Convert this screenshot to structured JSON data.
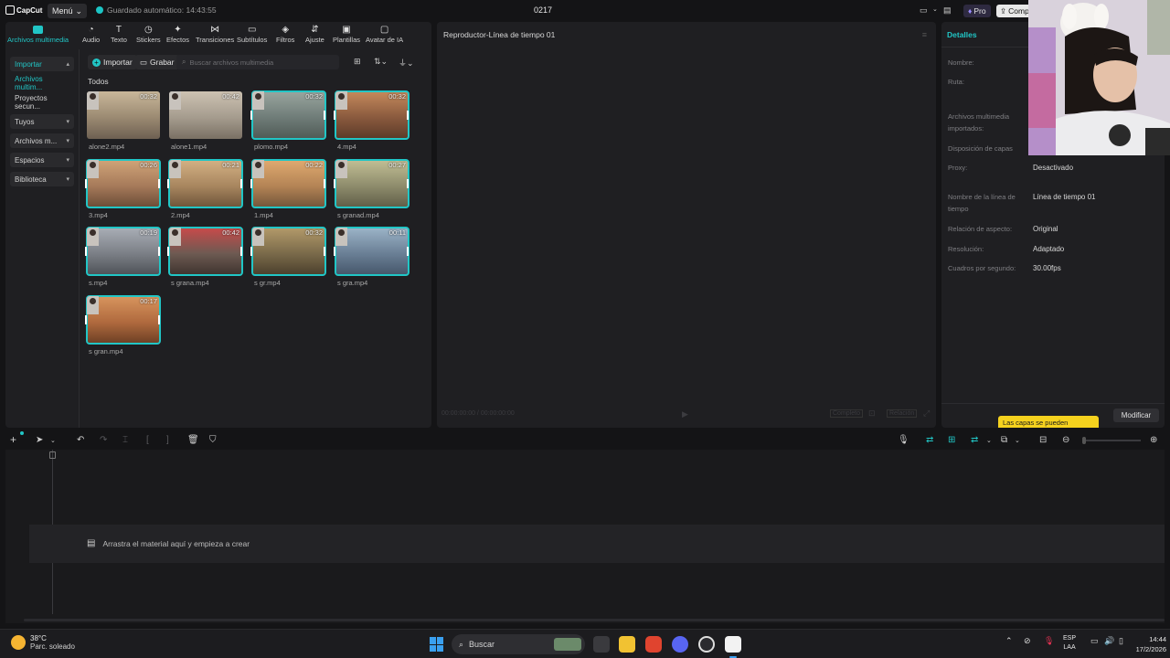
{
  "titlebar": {
    "logo_text": "CapCut",
    "menu_label": "Menú",
    "autosave": "Guardado automático: 14:43:55",
    "project_title": "0217",
    "pro_label": "Pro",
    "comp_label": "Comp"
  },
  "toolbar": {
    "items": [
      {
        "label": "Archivos multimedia",
        "icon": "media-icon",
        "active": true
      },
      {
        "label": "Audio",
        "icon": "audio-icon"
      },
      {
        "label": "Texto",
        "icon": "text-icon"
      },
      {
        "label": "Stickers",
        "icon": "sticker-icon"
      },
      {
        "label": "Efectos",
        "icon": "effects-icon"
      },
      {
        "label": "Transiciones",
        "icon": "transitions-icon"
      },
      {
        "label": "Subtítulos",
        "icon": "subtitles-icon"
      },
      {
        "label": "Filtros",
        "icon": "filters-icon"
      },
      {
        "label": "Ajuste",
        "icon": "adjust-icon"
      },
      {
        "label": "Plantillas",
        "icon": "templates-icon"
      },
      {
        "label": "Avatar de IA",
        "icon": "ai-avatar-icon"
      }
    ]
  },
  "sidebar": {
    "items": [
      {
        "label": "Importar",
        "chevron": "▴",
        "active": true
      },
      {
        "label": "Archivos multim...",
        "active": true,
        "plain": true
      },
      {
        "label": "Proyectos secun...",
        "plain": true
      },
      {
        "label": "Tuyos",
        "chevron": "▾"
      },
      {
        "label": "Archivos m...",
        "chevron": "▾"
      },
      {
        "label": "Espacios",
        "chevron": "▾"
      },
      {
        "label": "Biblioteca",
        "chevron": "▾"
      }
    ]
  },
  "media": {
    "import_label": "Importar",
    "record_label": "Grabar",
    "search_placeholder": "Buscar archivos multimedia",
    "section": "Todos",
    "clips": [
      {
        "name": "alone2.mp4",
        "duration": "00:32",
        "selected": false
      },
      {
        "name": "alone1.mp4",
        "duration": "00:42",
        "selected": false
      },
      {
        "name": "plomo.mp4",
        "duration": "00:32",
        "selected": true
      },
      {
        "name": "4.mp4",
        "duration": "00:32",
        "selected": true
      },
      {
        "name": "3.mp4",
        "duration": "00:26",
        "selected": true
      },
      {
        "name": "2.mp4",
        "duration": "00:21",
        "selected": true
      },
      {
        "name": "1.mp4",
        "duration": "00:22",
        "selected": true
      },
      {
        "name": "s granad.mp4",
        "duration": "00:27",
        "selected": true
      },
      {
        "name": "s.mp4",
        "duration": "00:19",
        "selected": true
      },
      {
        "name": "s grana.mp4",
        "duration": "00:42",
        "selected": true
      },
      {
        "name": "s gr.mp4",
        "duration": "00:32",
        "selected": true
      },
      {
        "name": "s gra.mp4",
        "duration": "00:11",
        "selected": true
      },
      {
        "name": "s gran.mp4",
        "duration": "00:17",
        "selected": true
      }
    ]
  },
  "player": {
    "title": "Reproductor-Línea de tiempo 01",
    "foot_left": "00:00:00:00 / 00:00:00:00",
    "foot_btn1": "Completo",
    "foot_btn2": "Relación"
  },
  "details": {
    "title": "Detalles",
    "rows": [
      {
        "key": "Nombre:",
        "value": ""
      },
      {
        "key": "Ruta:",
        "value": ""
      },
      {
        "key": "Archivos multimedia importados:",
        "value": ""
      },
      {
        "key": "Disposición de capas",
        "value": ""
      },
      {
        "key": "Proxy:",
        "value": "Desactivado"
      },
      {
        "key": "Nombre de la línea de tiempo",
        "value": "Línea de tiempo 01"
      },
      {
        "key": "Relación de aspecto:",
        "value": "Original"
      },
      {
        "key": "Resolución:",
        "value": "Adaptado"
      },
      {
        "key": "Cuadros por segundo:",
        "value": "30.00fps"
      }
    ],
    "tooltip": "Las capas se pueden",
    "modify_label": "Modificar"
  },
  "timeline": {
    "drop_text": "Arrastra el material aquí y empieza a crear"
  },
  "taskbar": {
    "temperature": "38°C",
    "weather": "Parc. soleado",
    "search_label": "Buscar",
    "lang_top": "ESP",
    "lang_bottom": "LAA",
    "time": "14:44",
    "date": "17/2/2026"
  },
  "colors": {
    "accent": "#21c6c6",
    "panel": "#1f1f22",
    "background": "#141416"
  }
}
